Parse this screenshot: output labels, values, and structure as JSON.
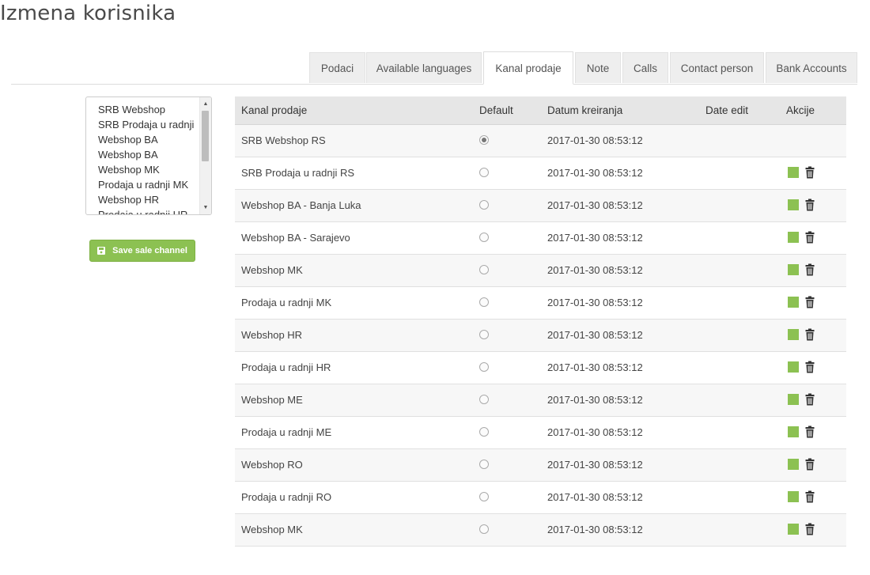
{
  "page": {
    "title": "Izmena korisnika"
  },
  "tabs": [
    {
      "label": "Podaci",
      "active": false
    },
    {
      "label": "Available languages",
      "active": false
    },
    {
      "label": "Kanal prodaje",
      "active": true
    },
    {
      "label": "Note",
      "active": false
    },
    {
      "label": "Calls",
      "active": false
    },
    {
      "label": "Contact person",
      "active": false
    },
    {
      "label": "Bank Accounts",
      "active": false
    }
  ],
  "channel_list": {
    "items": [
      "SRB Webshop",
      "SRB Prodaja u radnji",
      "Webshop BA",
      "Webshop BA",
      "Webshop MK",
      "Prodaja u radnji MK",
      "Webshop HR",
      "Prodaja u radnji HR"
    ]
  },
  "save_button": {
    "label": "Save sale channel",
    "icon": "floppy-disk-icon"
  },
  "table": {
    "headers": {
      "channel": "Kanal prodaje",
      "default": "Default",
      "created": "Datum kreiranja",
      "edited": "Date edit",
      "actions": "Akcije"
    },
    "rows": [
      {
        "channel": "SRB Webshop RS",
        "default": true,
        "created": "2017-01-30 08:53:12",
        "edited": "",
        "actions": false
      },
      {
        "channel": "SRB Prodaja u radnji RS",
        "default": false,
        "created": "2017-01-30 08:53:12",
        "edited": "",
        "actions": true
      },
      {
        "channel": "Webshop BA - Banja Luka",
        "default": false,
        "created": "2017-01-30 08:53:12",
        "edited": "",
        "actions": true
      },
      {
        "channel": "Webshop BA - Sarajevo",
        "default": false,
        "created": "2017-01-30 08:53:12",
        "edited": "",
        "actions": true
      },
      {
        "channel": "Webshop MK",
        "default": false,
        "created": "2017-01-30 08:53:12",
        "edited": "",
        "actions": true
      },
      {
        "channel": "Prodaja u radnji MK",
        "default": false,
        "created": "2017-01-30 08:53:12",
        "edited": "",
        "actions": true
      },
      {
        "channel": "Webshop HR",
        "default": false,
        "created": "2017-01-30 08:53:12",
        "edited": "",
        "actions": true
      },
      {
        "channel": "Prodaja u radnji HR",
        "default": false,
        "created": "2017-01-30 08:53:12",
        "edited": "",
        "actions": true
      },
      {
        "channel": "Webshop ME",
        "default": false,
        "created": "2017-01-30 08:53:12",
        "edited": "",
        "actions": true
      },
      {
        "channel": "Prodaja u radnji ME",
        "default": false,
        "created": "2017-01-30 08:53:12",
        "edited": "",
        "actions": true
      },
      {
        "channel": "Webshop RO",
        "default": false,
        "created": "2017-01-30 08:53:12",
        "edited": "",
        "actions": true
      },
      {
        "channel": "Prodaja u radnji RO",
        "default": false,
        "created": "2017-01-30 08:53:12",
        "edited": "",
        "actions": true
      },
      {
        "channel": "Webshop MK",
        "default": false,
        "created": "2017-01-30 08:53:12",
        "edited": "",
        "actions": true
      }
    ]
  },
  "colors": {
    "accent_green": "#8cc152",
    "header_bg": "#e6e6e6",
    "tab_bg": "#eeeeee"
  }
}
